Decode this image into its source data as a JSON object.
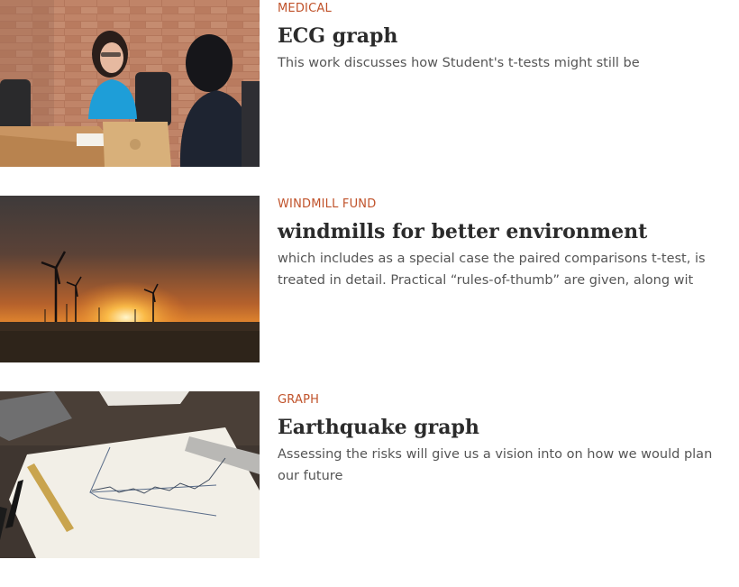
{
  "theme": {
    "category_color": "#c0522a",
    "title_color": "#2b2b2b",
    "text_color": "#555555"
  },
  "posts": [
    {
      "category": "MEDICAL",
      "title": "ECG graph",
      "excerpt": "This work discusses how Student's t-tests might still be",
      "image": "office-meeting-photo"
    },
    {
      "category": "WINDMILL FUND",
      "title": "windmills for better environment",
      "excerpt": "which includes as a special case the paired comparisons t-test, is treated in detail. Practical “rules-of-thumb” are given, along wit",
      "image": "wind-turbines-sunset-photo"
    },
    {
      "category": "GRAPH",
      "title": "Earthquake graph",
      "excerpt": "Assessing the risks will give us a vision into on how we would plan our future",
      "image": "hand-drawn-graph-photo"
    }
  ]
}
